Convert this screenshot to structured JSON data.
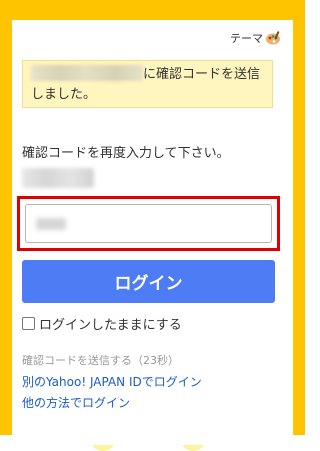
{
  "header": {
    "theme_label": "テーマ",
    "theme_icon": "palette-icon"
  },
  "notice": {
    "text_after_email": "に確認コードを送信しました。"
  },
  "form": {
    "instruction": "確認コードを再度入力して下さい。",
    "code_input_placeholder": "",
    "login_button": "ログイン",
    "keep_login_label": "ログインしたままにする",
    "keep_login_checked": false
  },
  "footer": {
    "resend_text": "確認コードを送信する（23秒）",
    "other_id_link": "別のYahoo! JAPAN IDでログイン",
    "other_method_link": "他の方法でログイン"
  },
  "colors": {
    "frame": "#ffc400",
    "notice_bg": "#fff5bf",
    "primary_button": "#4d7cf4",
    "highlight_border": "#e00000",
    "link": "#1a5dc8"
  }
}
